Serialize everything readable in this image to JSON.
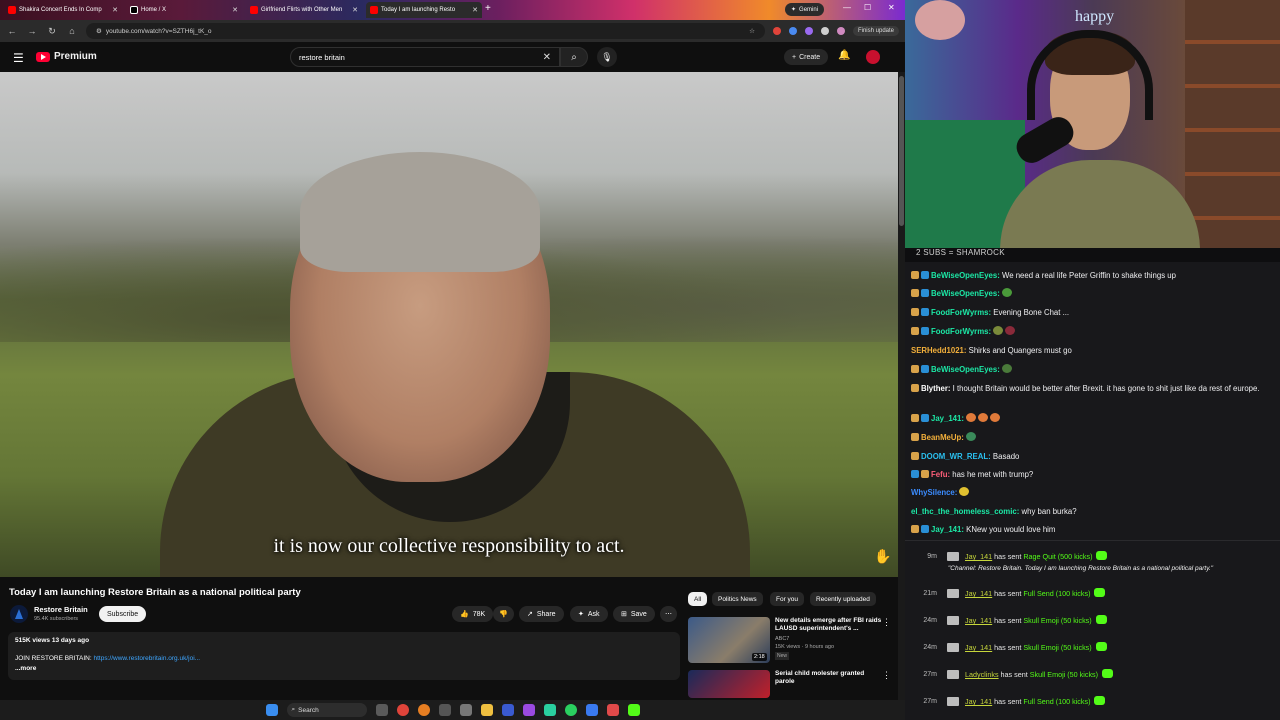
{
  "browser": {
    "tabs": [
      {
        "label": "Shakira Concert Ends In Comp"
      },
      {
        "label": "Home / X"
      },
      {
        "label": "Girlfriend Flirts with Other Men"
      },
      {
        "label": "Today I am launching Resto"
      }
    ],
    "gemini_label": "Gemini",
    "url": "youtube.com/watch?v=SZTH6j_tK_o",
    "finish_update": "Finish update"
  },
  "youtube": {
    "logo_label": "Premium",
    "search_value": "restore britain",
    "create_label": "Create",
    "video": {
      "subtitle": "it is now our collective responsibility to act.",
      "title": "Today I am launching Restore Britain as a national political party",
      "channel_name": "Restore Britain",
      "channel_subs": "95.4K subscribers",
      "subscribe_label": "Subscribe",
      "likes": "78K",
      "share_label": "Share",
      "ask_label": "Ask",
      "save_label": "Save",
      "meta": "515K views  13 days ago",
      "desc_prefix": "JOIN RESTORE BRITAIN: ",
      "desc_link": "https://www.restorebritain.org.uk/joi...",
      "more_label": "...more"
    },
    "chips": [
      "All",
      "Politics News",
      "For you",
      "Recently uploaded"
    ],
    "recommendations": [
      {
        "title": "New details emerge after FBI raids LAUSD superintendent's ...",
        "channel": "ABC7",
        "views": "15K views · 9 hours ago",
        "badge": "New",
        "duration": "2:18"
      },
      {
        "title": "Serial child molester granted parole",
        "channel": "",
        "views": "",
        "badge": "",
        "duration": ""
      }
    ]
  },
  "taskbar": {
    "search_label": "Search"
  },
  "stream": {
    "cam_text": "happy",
    "chat_banner": "2 SUBS = SHAMROCK",
    "chat": [
      {
        "user": "BeWiseOpenEyes:",
        "color": "#1ce8a6",
        "text": "We need a real life Peter Griffin to shake things up"
      },
      {
        "user": "BeWiseOpenEyes:",
        "color": "#1ce8a6",
        "text": ""
      },
      {
        "user": "FoodForWyrms:",
        "color": "#1ce8a6",
        "text": "Evening Bone Chat ..."
      },
      {
        "user": "FoodForWyrms:",
        "color": "#1ce8a6",
        "text": ""
      },
      {
        "user": "SERHedd1021:",
        "color": "#f3b03b",
        "text": "Shirks and Quangers must go"
      },
      {
        "user": "BeWiseOpenEyes:",
        "color": "#1ce8a6",
        "text": ""
      },
      {
        "user": "Blyther:",
        "color": "#ffffff",
        "text": "I thought Britain would be better after Brexit. it has gone to shit just like da rest of europe."
      },
      {
        "user": "Jay_141:",
        "color": "#1ce8a6",
        "text": ""
      },
      {
        "user": "BeanMeUp:",
        "color": "#f3b03b",
        "text": ""
      },
      {
        "user": "DOOM_WR_REAL:",
        "color": "#2ac0f0",
        "text": "Basado"
      },
      {
        "user": "Fefu:",
        "color": "#ff5f7a",
        "text": "has he met with trump?"
      },
      {
        "user": "WhySilence:",
        "color": "#3b8cff",
        "text": ""
      },
      {
        "user": "el_thc_the_homeless_comic:",
        "color": "#1ce8a6",
        "text": "why ban burka?"
      },
      {
        "user": "Jay_141:",
        "color": "#1ce8a6",
        "text": "KNew you would love him"
      }
    ],
    "events": [
      {
        "time": "9m",
        "user": "Jay_141",
        "mid": " has sent ",
        "gift": "Rage Quit (500 kicks)"
      },
      {
        "time": "21m",
        "user": "Jay_141",
        "mid": " has sent ",
        "gift": "Full Send (100 kicks)"
      },
      {
        "time": "24m",
        "user": "Jay_141",
        "mid": " has sent ",
        "gift": "Skull Emoji (50 kicks)"
      },
      {
        "time": "24m",
        "user": "Jay_141",
        "mid": " has sent ",
        "gift": "Skull Emoji (50 kicks)"
      },
      {
        "time": "27m",
        "user": "Ladyclinks",
        "mid": " has sent ",
        "gift": "Skull Emoji (50 kicks)"
      },
      {
        "time": "27m",
        "user": "Jay_141",
        "mid": " has sent ",
        "gift": "Full Send (100 kicks)"
      }
    ],
    "event_quote": "\"Channel: Restore Britain. Today I am launching Restore Britain as a national political party.\""
  }
}
